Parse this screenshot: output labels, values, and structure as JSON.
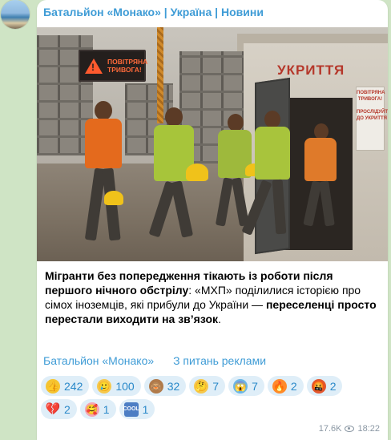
{
  "channel": {
    "name": "Батальйон «Монако» | Україна | Новини"
  },
  "photo": {
    "alarm_sign": "ПОВІТРЯНА\nТРИВОГА!",
    "shelter_sign": "УКРИТТЯ",
    "side_sign": "ПОВІТРЯНА\nТРИВОГА!\n\nПРОСЛІДУЙТЕ\nДО УКРИТТЯ"
  },
  "post": {
    "caption_bold_1": "Мігранти без попередження тікають із роботи після першого нічного обстрілу",
    "caption_plain": ": «МХП» поділилися історією про сімох іноземців, які прибули до України — ",
    "caption_bold_2": "переселенці просто перестали виходити на зв’язок",
    "caption_end": "."
  },
  "links": {
    "channel_link": "Батальйон «Монако»",
    "ads_link": "З питань реклами"
  },
  "reactions": [
    {
      "icon": "thumbs-up-icon",
      "glyph": "👍",
      "count": "242"
    },
    {
      "icon": "smiling-face-tear-icon",
      "glyph": "🥲",
      "count": "100"
    },
    {
      "icon": "see-no-evil-monkey-icon",
      "glyph": "🙈",
      "count": "32"
    },
    {
      "icon": "thinking-face-icon",
      "glyph": "🤔",
      "count": "7"
    },
    {
      "icon": "screaming-face-icon",
      "glyph": "😱",
      "count": "7"
    },
    {
      "icon": "fire-icon",
      "glyph": "🔥",
      "count": "2"
    },
    {
      "icon": "angry-face-icon",
      "glyph": "🤬",
      "count": "2"
    },
    {
      "icon": "broken-heart-icon",
      "glyph": "💔",
      "count": "2"
    },
    {
      "icon": "smiling-face-hearts-icon",
      "glyph": "🥰",
      "count": "1"
    },
    {
      "icon": "cool-button-icon",
      "glyph": "COOL",
      "count": "1"
    }
  ],
  "meta": {
    "views": "17.6K",
    "time": "18:22"
  }
}
